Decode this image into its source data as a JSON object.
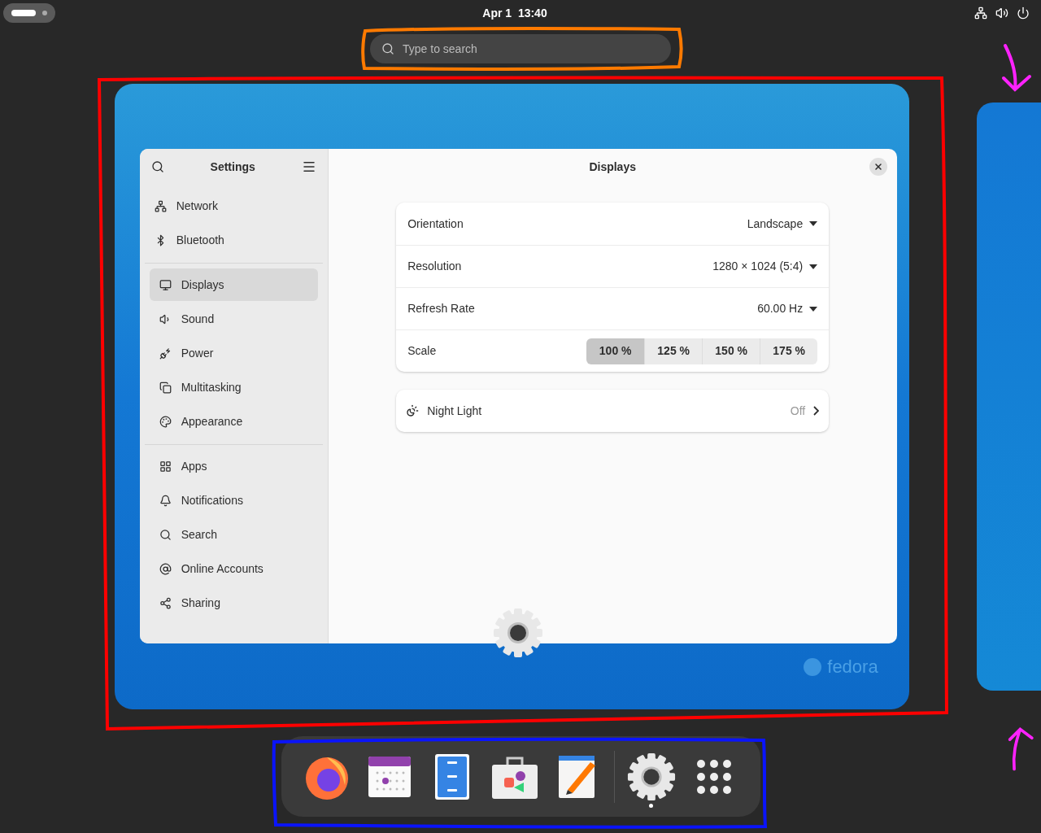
{
  "top_bar": {
    "clock": "Apr 1  13:40"
  },
  "search": {
    "placeholder": "Type to search"
  },
  "window": {
    "title": "Settings",
    "page_title": "Displays"
  },
  "sidebar": {
    "groups": [
      {
        "items": [
          {
            "label": "Network",
            "selected": false
          },
          {
            "label": "Bluetooth",
            "selected": false
          }
        ]
      },
      {
        "items": [
          {
            "label": "Displays",
            "selected": true
          },
          {
            "label": "Sound",
            "selected": false
          },
          {
            "label": "Power",
            "selected": false
          },
          {
            "label": "Multitasking",
            "selected": false
          },
          {
            "label": "Appearance",
            "selected": false
          }
        ]
      },
      {
        "items": [
          {
            "label": "Apps",
            "selected": false
          },
          {
            "label": "Notifications",
            "selected": false
          },
          {
            "label": "Search",
            "selected": false
          },
          {
            "label": "Online Accounts",
            "selected": false
          },
          {
            "label": "Sharing",
            "selected": false
          }
        ]
      }
    ]
  },
  "display_settings": [
    {
      "kind": "dropdown",
      "label": "Orientation",
      "value": "Landscape"
    },
    {
      "kind": "dropdown",
      "label": "Resolution",
      "value": "1280 × 1024 (5:4)"
    },
    {
      "kind": "dropdown",
      "label": "Refresh Rate",
      "value": "60.00 Hz"
    },
    {
      "kind": "scale",
      "label": "Scale",
      "options": [
        {
          "label": "100 %",
          "selected": true
        },
        {
          "label": "125 %",
          "selected": false
        },
        {
          "label": "150 %",
          "selected": false
        },
        {
          "label": "175 %",
          "selected": false
        }
      ]
    }
  ],
  "night_light": {
    "label": "Night Light",
    "value": "Off"
  },
  "wallpaper_logo": "fedora",
  "dock": {
    "apps": [
      {
        "kind": "browser",
        "running": false
      },
      {
        "kind": "calendar",
        "running": false
      },
      {
        "kind": "files",
        "running": false
      },
      {
        "kind": "software",
        "running": false
      },
      {
        "kind": "editor",
        "running": false
      },
      {
        "kind": "settings",
        "running": true
      },
      {
        "kind": "app-grid",
        "running": false
      }
    ]
  },
  "annotations": [
    {
      "kind": "box",
      "color": "#ff7a00"
    },
    {
      "kind": "box",
      "color": "#ff0000"
    },
    {
      "kind": "box",
      "color": "#0a14ff"
    },
    {
      "kind": "arrow-down",
      "color": "#ff22ff"
    },
    {
      "kind": "arrow-up",
      "color": "#ff22ff"
    }
  ]
}
